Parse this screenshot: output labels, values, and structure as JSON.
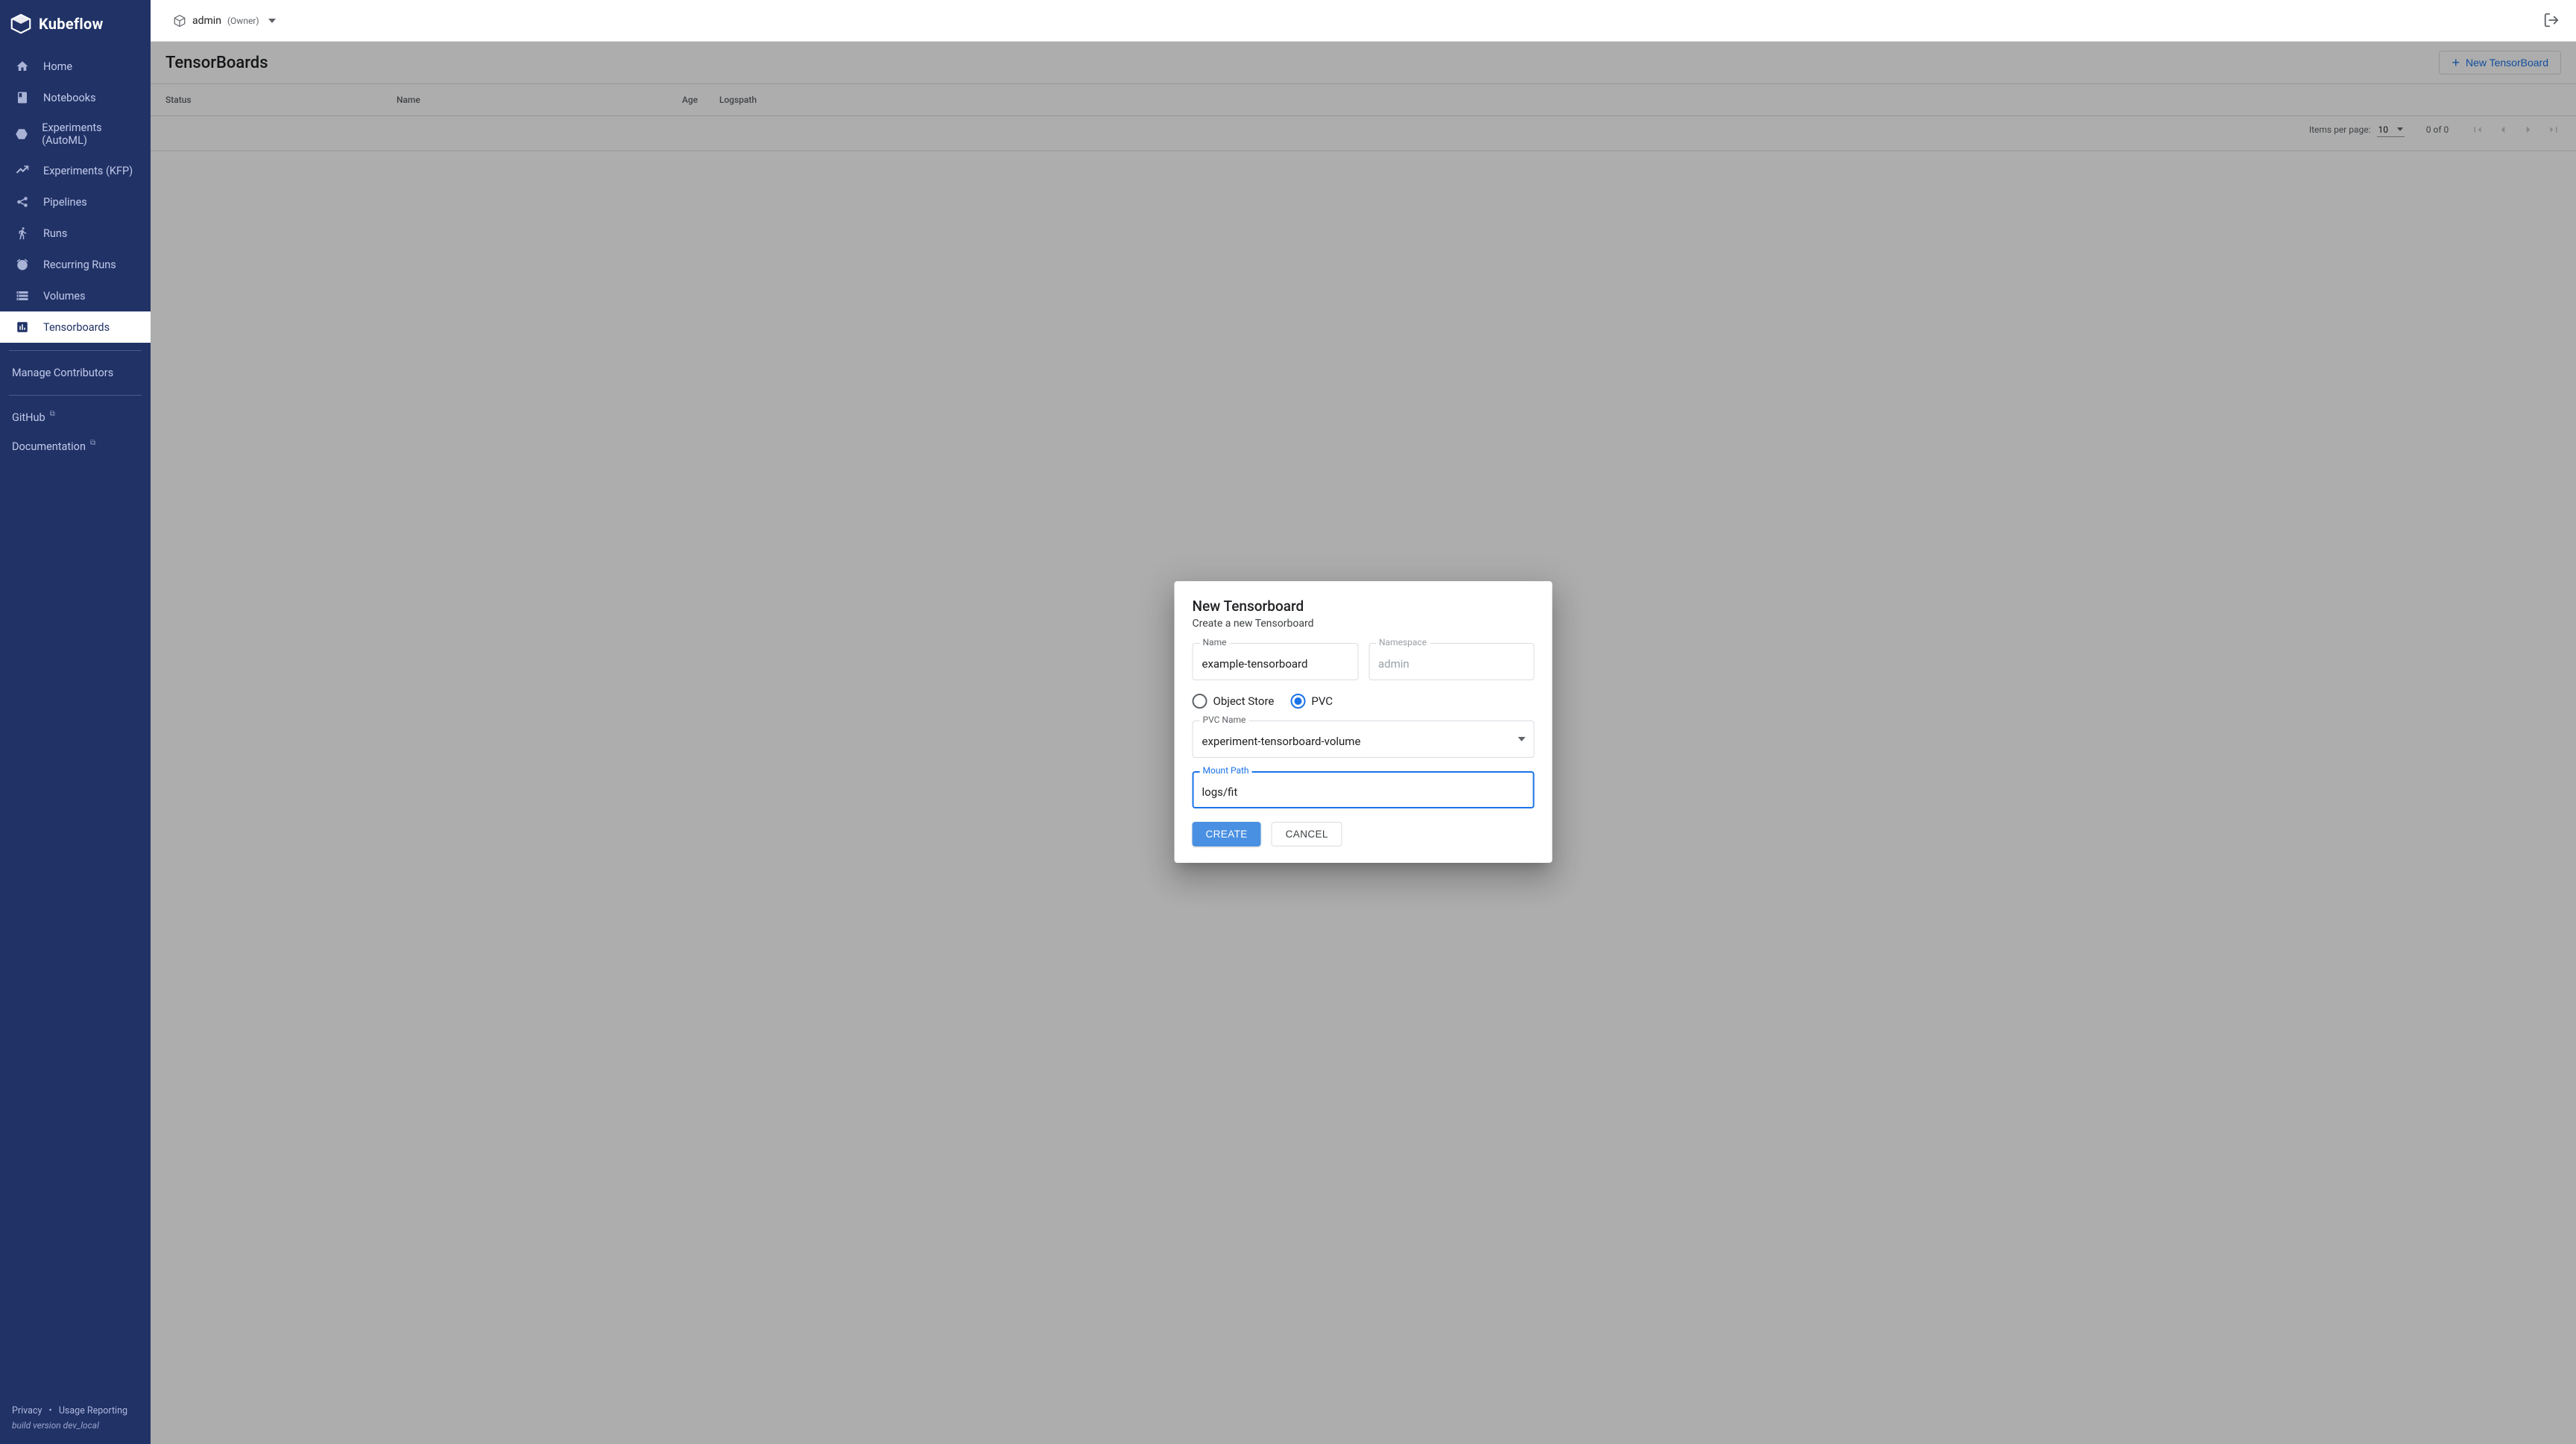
{
  "brand": {
    "name": "Kubeflow"
  },
  "sidebar": {
    "items": [
      {
        "label": "Home",
        "icon": "home-icon"
      },
      {
        "label": "Notebooks",
        "icon": "book-icon"
      },
      {
        "label": "Experiments (AutoML)",
        "icon": "hexagon-icon"
      },
      {
        "label": "Experiments (KFP)",
        "icon": "chart-line-icon"
      },
      {
        "label": "Pipelines",
        "icon": "share-icon"
      },
      {
        "label": "Runs",
        "icon": "run-icon"
      },
      {
        "label": "Recurring Runs",
        "icon": "alarm-icon"
      },
      {
        "label": "Volumes",
        "icon": "storage-icon"
      },
      {
        "label": "Tensorboards",
        "icon": "bar-chart-icon"
      }
    ],
    "manage_contributors": "Manage Contributors",
    "github": "GitHub",
    "documentation": "Documentation",
    "footer": {
      "privacy": "Privacy",
      "usage": "Usage Reporting",
      "build": "build version dev_local"
    }
  },
  "topbar": {
    "namespace": "admin",
    "role": "(Owner)"
  },
  "header": {
    "title": "TensorBoards",
    "new_button": "New TensorBoard"
  },
  "table": {
    "columns": {
      "status": "Status",
      "name": "Name",
      "age": "Age",
      "logspath": "Logspath"
    },
    "rows": []
  },
  "paginator": {
    "label": "Items per page:",
    "page_size": "10",
    "range": "0 of 0"
  },
  "dialog": {
    "title": "New Tensorboard",
    "subtitle": "Create a new Tensorboard",
    "fields": {
      "name_label": "Name",
      "name_value": "example-tensorboard",
      "ns_label": "Namespace",
      "ns_value": "admin",
      "radio_object_store": "Object Store",
      "radio_pvc": "PVC",
      "pvc_name_label": "PVC Name",
      "pvc_name_value": "experiment-tensorboard-volume",
      "mount_path_label": "Mount Path",
      "mount_path_value": "logs/fit"
    },
    "actions": {
      "create": "CREATE",
      "cancel": "CANCEL"
    }
  }
}
